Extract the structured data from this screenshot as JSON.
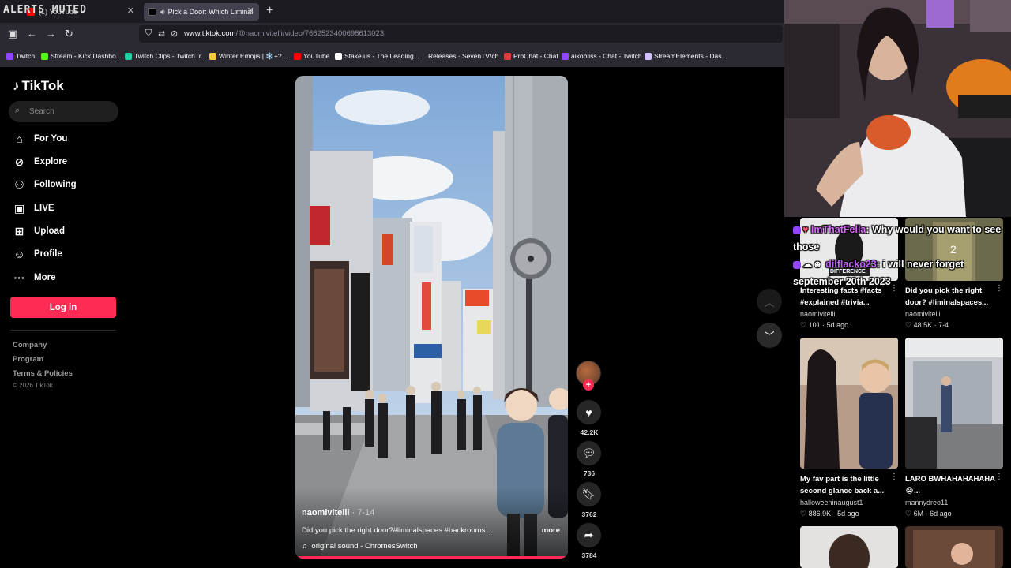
{
  "overlay": {
    "alerts": "ALERTS MUTED"
  },
  "browser": {
    "tabs": [
      {
        "label": "(1) YouTube"
      },
      {
        "label": "Pick a Door: Which Liminal"
      }
    ],
    "url_host": "www.tiktok.com",
    "url_path": "/@naomivitelli/video/7662523400698613023",
    "bookmarks": [
      {
        "label": "Twitch",
        "color": "#9146ff"
      },
      {
        "label": "Stream - Kick Dashbo...",
        "color": "#53fc18"
      },
      {
        "label": "Twitch Clips - TwitchTr...",
        "color": "#1fd1a5"
      },
      {
        "label": "Winter Emojis | ❄️+?...",
        "color": "#f7c948"
      },
      {
        "label": "YouTube",
        "color": "#ff0000"
      },
      {
        "label": "Stake.us - The Leading...",
        "color": "#ffffff"
      },
      {
        "label": "Releases · SevenTV/ch...",
        "color": "#2b2a33"
      },
      {
        "label": "ProChat - Chat",
        "color": "#e03b3b"
      },
      {
        "label": "aikobliss - Chat - Twitch",
        "color": "#9146ff"
      },
      {
        "label": "StreamElements - Das...",
        "color": "#d0c0ff"
      }
    ]
  },
  "sidebar": {
    "brand": "TikTok",
    "search_placeholder": "Search",
    "nav": [
      {
        "label": "For You",
        "icon": "home-icon"
      },
      {
        "label": "Explore",
        "icon": "compass-icon"
      },
      {
        "label": "Following",
        "icon": "following-icon"
      },
      {
        "label": "LIVE",
        "icon": "live-icon"
      },
      {
        "label": "Upload",
        "icon": "upload-icon"
      },
      {
        "label": "Profile",
        "icon": "profile-icon"
      },
      {
        "label": "More",
        "icon": "more-icon"
      }
    ],
    "login": "Log in",
    "footer": [
      "Company",
      "Program",
      "Terms & Policies"
    ],
    "copyright": "© 2026 TikTok"
  },
  "video": {
    "author": "naomivitelli",
    "date": "· 7-14",
    "description": "Did you pick the right door?#liminalspaces #backrooms ...",
    "more": "more",
    "sound": "original sound - ChromesSwitch",
    "likes": "42.2K",
    "comments": "736",
    "saves": "3762",
    "shares": "3784",
    "progress": 1.0
  },
  "chat": [
    {
      "user": "ImThatFella",
      "message": ": Why would you want to see those"
    },
    {
      "user": "dilflacko23",
      "message": ": i will never forget september 20th 2023"
    }
  ],
  "grid": [
    {
      "title": "Interesting facts #facts #explained #trivia...",
      "author": "naomivitelli",
      "likes": "101",
      "date": "5d ago",
      "thumb_label": "DIFFERENCE"
    },
    {
      "title": "Did you pick the right door? #liminalspaces...",
      "author": "naomivitelli",
      "likes": "48.5K",
      "date": "7-4",
      "thumb_label": "2"
    },
    {
      "title": "My fav part is the little second glance back a...",
      "author": "halloweeninaugust1",
      "likes": "886.9K",
      "date": "5d ago"
    },
    {
      "title": "LARO BWHAHAHAHAHA 😭...",
      "author": "mannydreo11",
      "likes": "6M",
      "date": "6d ago"
    }
  ]
}
